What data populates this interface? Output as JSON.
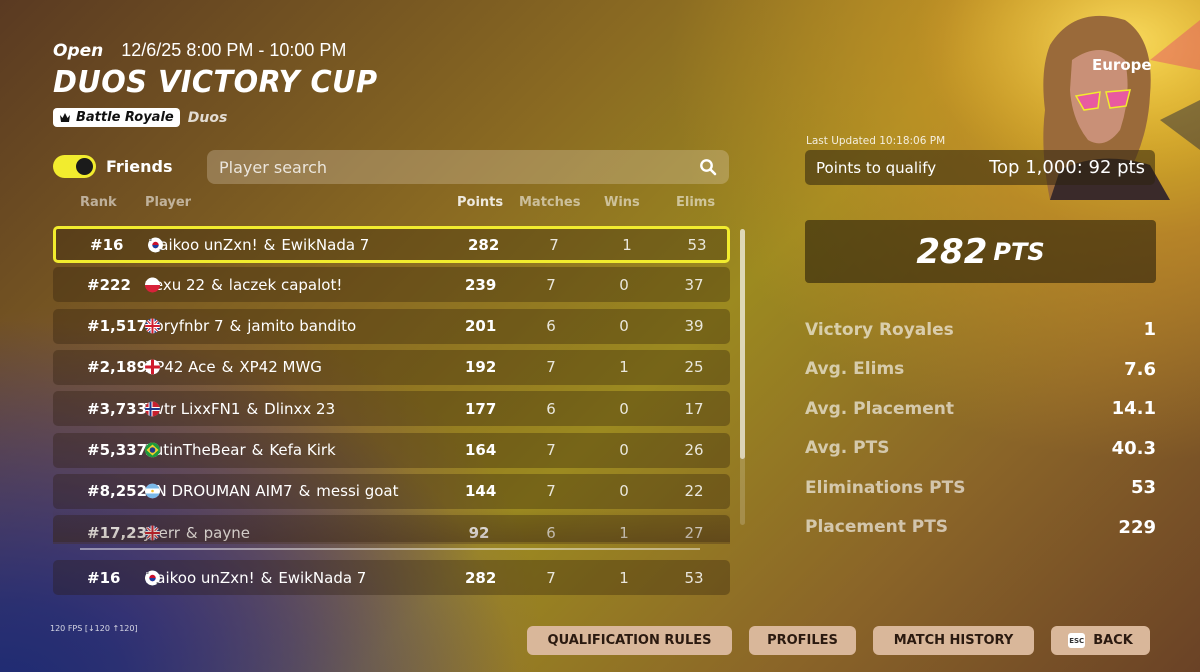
{
  "event": {
    "status": "Open",
    "time_range": "12/6/25 8:00 PM - 10:00 PM",
    "title": "DUOS VICTORY CUP",
    "mode_tag": "Battle Royale",
    "mode_sub": "Duos",
    "region": "Europe"
  },
  "friends": {
    "label": "Friends",
    "enabled": true
  },
  "search": {
    "placeholder": "Player search"
  },
  "table": {
    "headers": {
      "rank": "Rank",
      "player": "Player",
      "points": "Points",
      "matches": "Matches",
      "wins": "Wins",
      "elims": "Elims"
    },
    "rows": [
      {
        "rank": "#16",
        "p1": "Haikoo unZxn!",
        "f1": "se",
        "p2": "EwikNada 7",
        "f2": "kr",
        "points": "282",
        "matches": "7",
        "wins": "1",
        "elims": "53"
      },
      {
        "rank": "#222",
        "p1": "vexu 22",
        "f1": "pl",
        "p2": "laczek capalot!",
        "f2": "pl",
        "points": "239",
        "matches": "7",
        "wins": "0",
        "elims": "37"
      },
      {
        "rank": "#1,517",
        "p1": "doryfnbr 7",
        "f1": "en",
        "p2": "jamito bandito",
        "f2": "gb",
        "points": "201",
        "matches": "6",
        "wins": "0",
        "elims": "39"
      },
      {
        "rank": "#2,189",
        "p1": "XP42 Ace",
        "f1": "gb",
        "p2": "XP42 MWG",
        "f2": "en",
        "points": "192",
        "matches": "7",
        "wins": "1",
        "elims": "25"
      },
      {
        "rank": "#3,733",
        "p1": "Twtr LixxFN1",
        "f1": "ng",
        "p2": "Dlinxx 23",
        "f2": "no",
        "points": "177",
        "matches": "6",
        "wins": "0",
        "elims": "17"
      },
      {
        "rank": "#5,337",
        "p1": "PutinTheBear",
        "f1": "en",
        "p2": "Kefa Kirk",
        "f2": "br",
        "points": "164",
        "matches": "7",
        "wins": "0",
        "elims": "26"
      },
      {
        "rank": "#8,252",
        "p1": "CN DROUMAN AIM7",
        "f1": "es",
        "p2": "messi goat",
        "f2": "ar",
        "points": "144",
        "matches": "7",
        "wins": "0",
        "elims": "22"
      },
      {
        "rank": "#17,231",
        "p1": "Joerr",
        "f1": "dk",
        "p2": "payne",
        "f2": "gb",
        "points": "92",
        "matches": "6",
        "wins": "1",
        "elims": "27"
      }
    ],
    "self_row": {
      "rank": "#16",
      "p1": "Haikoo unZxn!",
      "f1": "se",
      "p2": "EwikNada 7",
      "f2": "kr",
      "points": "282",
      "matches": "7",
      "wins": "1",
      "elims": "53"
    }
  },
  "summary": {
    "last_updated": "Last Updated 10:18:06 PM",
    "qualify_label": "Points to qualify",
    "qualify_value": "Top 1,000: 92 pts",
    "total_points": "282",
    "total_unit": "PTS",
    "stats": [
      {
        "label": "Victory Royales",
        "value": "1"
      },
      {
        "label": "Avg. Elims",
        "value": "7.6"
      },
      {
        "label": "Avg. Placement",
        "value": "14.1"
      },
      {
        "label": "Avg. PTS",
        "value": "40.3"
      },
      {
        "label": "Eliminations PTS",
        "value": "53"
      },
      {
        "label": "Placement PTS",
        "value": "229"
      }
    ]
  },
  "footer": {
    "fps": "120 FPS [↓120 ↑120]",
    "buttons": {
      "qualification_rules": "QUALIFICATION RULES",
      "profiles": "PROFILES",
      "match_history": "MATCH HISTORY",
      "back": "BACK",
      "esc": "ESC"
    }
  },
  "colors": {
    "accent_yellow": "#f2ec2e",
    "button_tan": "#d9b79a"
  }
}
